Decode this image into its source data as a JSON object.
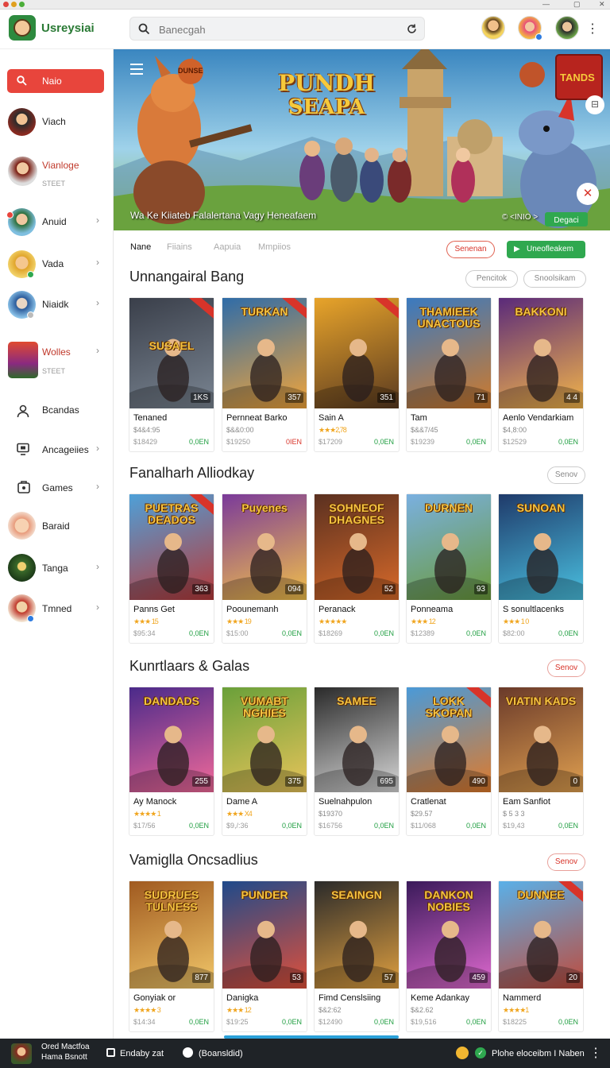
{
  "app": {
    "brand": "Usreysiai"
  },
  "search": {
    "placeholder": "Banecgah"
  },
  "sidebar": {
    "home_label": "Naio",
    "items": [
      {
        "label": "Viach",
        "sub": "",
        "chevron": false
      },
      {
        "label": "Vianloge",
        "sub": "STEET",
        "chevron": false
      },
      {
        "label": "Anuid",
        "sub": "",
        "chevron": true
      },
      {
        "label": "Vada",
        "sub": "",
        "chevron": true
      },
      {
        "label": "Niaidk",
        "sub": "",
        "chevron": true
      },
      {
        "label": "Wolles",
        "sub": "STEET",
        "chevron": true
      },
      {
        "label": "Bcandas",
        "sub": "",
        "chevron": false
      },
      {
        "label": "Ancageiies",
        "sub": "",
        "chevron": true
      },
      {
        "label": "Games",
        "sub": "",
        "chevron": true
      },
      {
        "label": "Baraid",
        "sub": "",
        "chevron": false
      },
      {
        "label": "Tanga",
        "sub": "",
        "chevron": true
      },
      {
        "label": "Tmned",
        "sub": "",
        "chevron": true
      }
    ]
  },
  "banner": {
    "title_line1": "PUNDH",
    "title_line2": "SEAPA",
    "left_badge": "DUNSE",
    "right_badge": "TANDS",
    "caption": "Wa Ke Kiiateb Falalertana Vagy Heneafaem",
    "footer_text": "© <INIO >",
    "cta": "Degaci"
  },
  "tabs": {
    "items": [
      "Nane",
      "Fiiains",
      "Aapuia",
      "Mmpiios"
    ],
    "btn_outline": "Senenan",
    "btn_primary": "Uneofleakem"
  },
  "sections": [
    {
      "title": "Unnangairal Bang",
      "pills": [
        "Pencitok",
        "Snoolsikam"
      ],
      "cards": [
        {
          "art": "SUSAEL",
          "num": "1KS",
          "name": "Tenaned",
          "meta": "$4&4:95",
          "price": "$18429",
          "status": "0,0EN",
          "status_red": false,
          "ribbon": true
        },
        {
          "art": "TURKAN",
          "num": "357",
          "name": "Pernneat Barko",
          "meta": "$&&0:00",
          "price": "$19250",
          "status": "0IEN",
          "status_red": true,
          "ribbon": true
        },
        {
          "art": "",
          "num": "351",
          "name": "Sain A",
          "meta": "★★★2,78",
          "price": "$17209",
          "status": "0,0EN",
          "status_red": false,
          "ribbon": true
        },
        {
          "art": "THAMIEEK UNACTOUS",
          "num": "71",
          "name": "Tam",
          "meta": "$&&7/45",
          "price": "$19239",
          "status": "0,0EN",
          "status_red": false,
          "ribbon": false
        },
        {
          "art": "BAKKONI",
          "num": "4 4",
          "name": "Aenlo Vendarkiam",
          "meta": "$4,8:00",
          "price": "$12529",
          "status": "0,0EN",
          "status_red": false,
          "ribbon": false
        }
      ]
    },
    {
      "title": "Fanalharh Alliodkay",
      "pills": [
        "Senov"
      ],
      "cards": [
        {
          "art": "PUETRAS DEADOS",
          "num": "363",
          "name": "Panns Get",
          "meta": "★★★ 15",
          "price": "$95:34",
          "status": "0,0EN",
          "status_red": false,
          "ribbon": true
        },
        {
          "art": "Puyenes",
          "num": "094",
          "name": "Poounemanh",
          "meta": "★★★ 19",
          "price": "$15:00",
          "status": "0,0EN",
          "status_red": false,
          "ribbon": false
        },
        {
          "art": "SOHNEOF DHAGNES",
          "num": "52",
          "name": "Peranack",
          "meta": "★★★★★",
          "price": "$18269",
          "status": "0,0EN",
          "status_red": false,
          "ribbon": false
        },
        {
          "art": "DURNEN",
          "num": "93",
          "name": "Ponneama",
          "meta": "★★★ 12",
          "price": "$12389",
          "status": "0,0EN",
          "status_red": false,
          "ribbon": false
        },
        {
          "art": "SUNOAN",
          "num": "",
          "name": "S sonultlacenks",
          "meta": "★★★ 1 0",
          "price": "$82:00",
          "status": "0,0EN",
          "status_red": false,
          "ribbon": false
        }
      ]
    },
    {
      "title": "Kunrtlaars & Galas",
      "pills": [
        "Senov"
      ],
      "cards": [
        {
          "art": "DANDADS",
          "num": "255",
          "name": "Ay Manock",
          "meta": "★★★★ 1",
          "price": "$17/56",
          "status": "0,0EN",
          "status_red": false,
          "ribbon": false
        },
        {
          "art": "VUMABT NGHIES",
          "num": "375",
          "name": "Dame A",
          "meta": "★★★ X4",
          "price": "$9,/:36",
          "status": "0,0EN",
          "status_red": false,
          "ribbon": false
        },
        {
          "art": "SAMEE",
          "num": "695",
          "name": "Suelnahpulon",
          "meta": "$19370",
          "price": "$16756",
          "status": "0,0EN",
          "status_red": false,
          "ribbon": false
        },
        {
          "art": "LOKK SKOPAN",
          "num": "490",
          "name": "Cratlenat",
          "meta": "$29.57",
          "price": "$11/068",
          "status": "0,0EN",
          "status_red": false,
          "ribbon": true
        },
        {
          "art": "VIATIN KADS",
          "num": "0",
          "name": "Eam Sanfiot",
          "meta": "$ 5 3 3",
          "price": "$19,43",
          "status": "0,0EN",
          "status_red": false,
          "ribbon": false
        }
      ]
    },
    {
      "title": "Vamiglla Oncsadlius",
      "pills": [
        "Senov"
      ],
      "cards": [
        {
          "art": "SUDRUES TULNESS",
          "num": "877",
          "name": "Gonyiak or",
          "meta": "★★★★ 3",
          "price": "$14:34",
          "status": "0,0EN",
          "status_red": false,
          "ribbon": false
        },
        {
          "art": "PUNDER",
          "num": "53",
          "name": "Danigka",
          "meta": "★★★ 12",
          "price": "$19:25",
          "status": "0,0EN",
          "status_red": false,
          "ribbon": false
        },
        {
          "art": "SEAINGN",
          "num": "57",
          "name": "Fimd Censlsiing",
          "meta": "$&2:62",
          "price": "$12490",
          "status": "0,0EN",
          "status_red": false,
          "ribbon": false
        },
        {
          "art": "DANKON NOBIES",
          "num": "459",
          "name": "Keme Adankay",
          "meta": "$&2.62",
          "price": "$19,516",
          "status": "0,0EN",
          "status_red": false,
          "ribbon": false
        },
        {
          "art": "DUNNEE",
          "num": "20",
          "name": "Nammerd",
          "meta": "★★★★1",
          "price": "$18225",
          "status": "0,0EN",
          "status_red": false,
          "ribbon": true
        }
      ]
    }
  ],
  "bottombar": {
    "profile_line1": "Ored Mactfoa",
    "profile_line2": "Hama Bsnott",
    "link1": "Endaby zat",
    "link2": "(Boansldid)",
    "right_text": "Plohe eloceibm I Naben"
  }
}
